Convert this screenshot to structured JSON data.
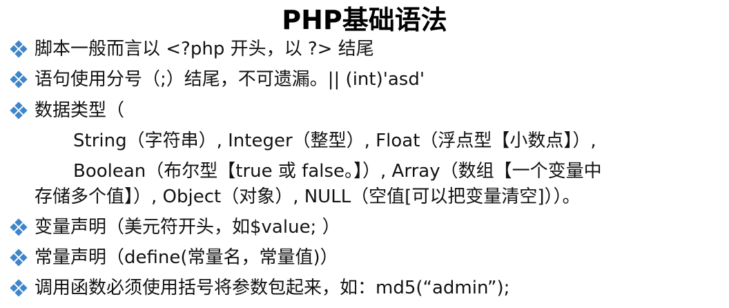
{
  "title": "PHP基础语法",
  "bullets": [
    "脚本一般而言以 <?php 开头，以 ?> 结尾",
    "语句使用分号（;）结尾，不可遗漏。|| (int)'asd'",
    "数据类型（",
    "变量声明（美元符开头，如$value; ）",
    "常量声明（define(常量名，常量值)）",
    "调用函数必须使用括号将参数包起来，如：md5(“admin”);"
  ],
  "datatypes": {
    "line1": "String（字符串）, Integer（整型）, Float（浮点型【小数点】）,",
    "line2": "Boolean（布尔型【true 或 false。】）, Array（数组【一个变量中",
    "line3": "存储多个值】）, Object（对象）, NULL（空值[可以把变量清空]））。"
  },
  "colors": {
    "bullet": "#3f86c9",
    "text": "#111111"
  },
  "icons": {
    "bullet": "diamond-bullet-icon"
  }
}
